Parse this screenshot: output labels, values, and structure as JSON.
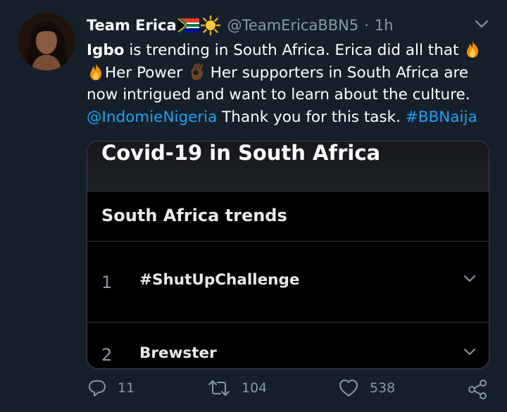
{
  "tweet": {
    "display_name": "Team Erica",
    "handle": "@TeamEricaBBN5",
    "separator": "·",
    "time": "1h",
    "text": {
      "bold_word": "Igbo",
      "part1": " is trending in South Africa. Erica did all that ",
      "part2": "Her Power ",
      "part3": " Her supporters in South Africa are now intrigued and want to learn about the culture. ",
      "mention": "@IndomieNigeria",
      "part4": " Thank you for this task. ",
      "hashtag": "#BBNaija"
    }
  },
  "card": {
    "title": "Covid-19 in South Africa",
    "trends_title": "South Africa trends",
    "trends": [
      {
        "rank": "1",
        "name": "#ShutUpChallenge"
      },
      {
        "rank": "2",
        "name": "Brewster"
      }
    ]
  },
  "actions": {
    "replies": "11",
    "retweets": "104",
    "likes": "538"
  },
  "colors": {
    "background": "#15202b",
    "link": "#1da1f2",
    "muted": "#8899a6"
  },
  "icons": [
    "fire-icon",
    "ok-hand-icon",
    "south-africa-flag-icon",
    "sun-icon",
    "reply-icon",
    "retweet-icon",
    "like-icon",
    "share-icon",
    "chevron-down-icon"
  ]
}
